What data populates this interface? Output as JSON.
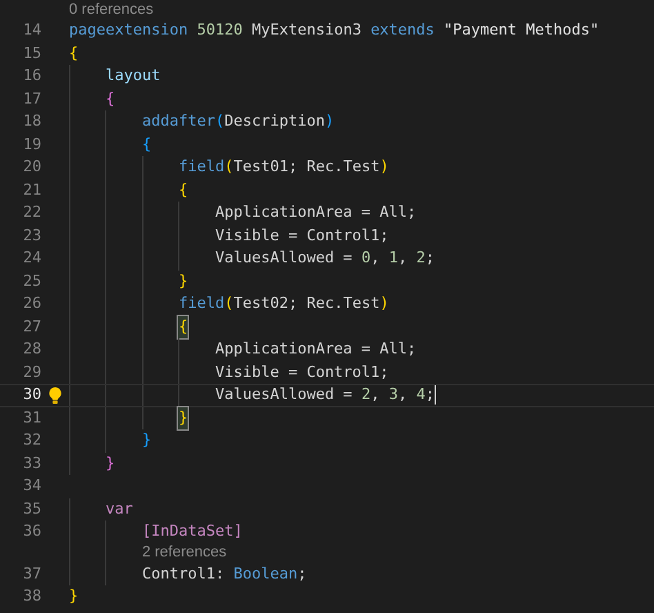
{
  "editor": {
    "lines": [
      {
        "kind": "codelens",
        "text": "0 references"
      },
      {
        "kind": "code",
        "number": "14",
        "current": false,
        "lightbulb": false,
        "tokens": [
          {
            "text": "pageextension",
            "kind": "keyword"
          },
          {
            "text": " 50120",
            "kind": "number"
          },
          {
            "text": " MyExtension3 ",
            "kind": "ident"
          },
          {
            "text": "extends",
            "kind": "keyword"
          },
          {
            "text": " \"Payment Methods\"",
            "kind": "string"
          }
        ]
      },
      {
        "kind": "code",
        "number": "15",
        "current": false,
        "lightbulb": false,
        "tokens": [
          {
            "text": "{",
            "kind": "brace1",
            "matched": false
          }
        ]
      },
      {
        "kind": "code",
        "number": "16",
        "current": false,
        "lightbulb": false,
        "tokens": [
          {
            "text": "    layout",
            "kind": "member"
          }
        ]
      },
      {
        "kind": "code",
        "number": "17",
        "current": false,
        "lightbulb": false,
        "tokens": [
          {
            "text": "    {",
            "kind": "brace2",
            "matched": false
          }
        ]
      },
      {
        "kind": "code",
        "number": "18",
        "current": false,
        "lightbulb": false,
        "tokens": [
          {
            "text": "        addafter",
            "kind": "keyword"
          },
          {
            "text": "(",
            "kind": "brace3",
            "matched": false
          },
          {
            "text": "Description",
            "kind": "ident"
          },
          {
            "text": ")",
            "kind": "brace3",
            "matched": false
          }
        ]
      },
      {
        "kind": "code",
        "number": "19",
        "current": false,
        "lightbulb": false,
        "tokens": [
          {
            "text": "        {",
            "kind": "brace3",
            "matched": false
          }
        ]
      },
      {
        "kind": "code",
        "number": "20",
        "current": false,
        "lightbulb": false,
        "tokens": [
          {
            "text": "            field",
            "kind": "keyword"
          },
          {
            "text": "(",
            "kind": "brace1",
            "matched": false
          },
          {
            "text": "Test01; Rec.Test",
            "kind": "ident"
          },
          {
            "text": ")",
            "kind": "brace1",
            "matched": false
          }
        ]
      },
      {
        "kind": "code",
        "number": "21",
        "current": false,
        "lightbulb": false,
        "tokens": [
          {
            "text": "            {",
            "kind": "brace1",
            "matched": false
          }
        ]
      },
      {
        "kind": "code",
        "number": "22",
        "current": false,
        "lightbulb": false,
        "tokens": [
          {
            "text": "                ApplicationArea = All;",
            "kind": "ident"
          }
        ]
      },
      {
        "kind": "code",
        "number": "23",
        "current": false,
        "lightbulb": false,
        "tokens": [
          {
            "text": "                Visible = Control1;",
            "kind": "ident"
          }
        ]
      },
      {
        "kind": "code",
        "number": "24",
        "current": false,
        "lightbulb": false,
        "tokens": [
          {
            "text": "                ValuesAllowed = ",
            "kind": "ident"
          },
          {
            "text": "0",
            "kind": "number"
          },
          {
            "text": ", ",
            "kind": "ident"
          },
          {
            "text": "1",
            "kind": "number"
          },
          {
            "text": ", ",
            "kind": "ident"
          },
          {
            "text": "2",
            "kind": "number"
          },
          {
            "text": ";",
            "kind": "ident"
          }
        ]
      },
      {
        "kind": "code",
        "number": "25",
        "current": false,
        "lightbulb": false,
        "tokens": [
          {
            "text": "            }",
            "kind": "brace1",
            "matched": false
          }
        ]
      },
      {
        "kind": "code",
        "number": "26",
        "current": false,
        "lightbulb": false,
        "tokens": [
          {
            "text": "            field",
            "kind": "keyword"
          },
          {
            "text": "(",
            "kind": "brace1",
            "matched": false
          },
          {
            "text": "Test02; Rec.Test",
            "kind": "ident"
          },
          {
            "text": ")",
            "kind": "brace1",
            "matched": false
          }
        ]
      },
      {
        "kind": "code",
        "number": "27",
        "current": false,
        "lightbulb": false,
        "tokens": [
          {
            "text": "            {",
            "kind": "brace1",
            "matched": true
          }
        ]
      },
      {
        "kind": "code",
        "number": "28",
        "current": false,
        "lightbulb": false,
        "tokens": [
          {
            "text": "                ApplicationArea = All;",
            "kind": "ident"
          }
        ]
      },
      {
        "kind": "code",
        "number": "29",
        "current": false,
        "lightbulb": false,
        "tokens": [
          {
            "text": "                Visible = Control1;",
            "kind": "ident"
          }
        ]
      },
      {
        "kind": "code",
        "number": "30",
        "current": true,
        "lightbulb": true,
        "tokens": [
          {
            "text": "                ValuesAllowed = ",
            "kind": "ident"
          },
          {
            "text": "2",
            "kind": "number"
          },
          {
            "text": ", ",
            "kind": "ident"
          },
          {
            "text": "3",
            "kind": "number"
          },
          {
            "text": ", ",
            "kind": "ident"
          },
          {
            "text": "4",
            "kind": "number"
          },
          {
            "text": ";",
            "kind": "ident"
          }
        ]
      },
      {
        "kind": "code",
        "number": "31",
        "current": false,
        "lightbulb": false,
        "tokens": [
          {
            "text": "            }",
            "kind": "brace1",
            "matched": true
          }
        ]
      },
      {
        "kind": "code",
        "number": "32",
        "current": false,
        "lightbulb": false,
        "tokens": [
          {
            "text": "        }",
            "kind": "brace3",
            "matched": false
          }
        ]
      },
      {
        "kind": "code",
        "number": "33",
        "current": false,
        "lightbulb": false,
        "tokens": [
          {
            "text": "    }",
            "kind": "brace2",
            "matched": false
          }
        ]
      },
      {
        "kind": "code",
        "number": "34",
        "current": false,
        "lightbulb": false
      },
      {
        "kind": "code",
        "number": "35",
        "current": false,
        "lightbulb": false,
        "tokens": [
          {
            "text": "    var",
            "kind": "control"
          }
        ]
      },
      {
        "kind": "code",
        "number": "36",
        "current": false,
        "lightbulb": false,
        "tokens": [
          {
            "text": "        [InDataSet]",
            "kind": "control"
          }
        ]
      },
      {
        "kind": "codelens",
        "text": "2 references",
        "indented": true
      },
      {
        "kind": "code",
        "number": "37",
        "current": false,
        "lightbulb": false,
        "tokens": [
          {
            "text": "        Control1: ",
            "kind": "ident"
          },
          {
            "text": "Boolean",
            "kind": "keyword"
          },
          {
            "text": ";",
            "kind": "ident"
          }
        ]
      },
      {
        "kind": "code",
        "number": "38",
        "current": false,
        "lightbulb": false,
        "tokens": [
          {
            "text": "}",
            "kind": "brace1",
            "matched": false
          }
        ]
      }
    ]
  }
}
